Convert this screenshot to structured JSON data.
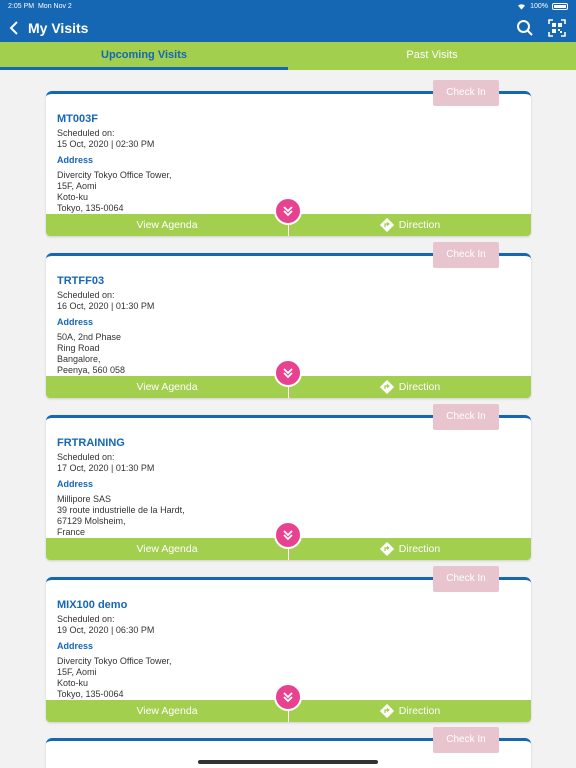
{
  "status_bar": {
    "time": "2:05 PM",
    "date": "Mon Nov 2",
    "battery": "100%"
  },
  "nav": {
    "title": "My Visits",
    "back_icon": "chevron-left-icon",
    "search_icon": "search-icon",
    "scan_icon": "qr-scan-icon"
  },
  "tabs": [
    {
      "label": "Upcoming Visits",
      "active": true
    },
    {
      "label": "Past Visits",
      "active": false
    }
  ],
  "labels": {
    "scheduled_on": "Scheduled on:",
    "address": "Address",
    "check_in": "Check In",
    "view_agenda": "View Agenda",
    "direction": "Direction"
  },
  "visits": [
    {
      "code": "MT003F",
      "scheduled": "15 Oct, 2020 | 02:30 PM",
      "address": [
        "Divercity Tokyo Office Tower,",
        "15F, Aomi",
        "Koto-ku",
        "Tokyo, 135-0064"
      ]
    },
    {
      "code": "TRTFF03",
      "scheduled": "16 Oct, 2020 | 01:30 PM",
      "address": [
        "50A, 2nd Phase",
        "Ring Road",
        "Bangalore,",
        "Peenya, 560 058"
      ]
    },
    {
      "code": "FRTRAINING",
      "scheduled": "17 Oct, 2020 | 01:30 PM",
      "address": [
        "Millipore SAS",
        "39 route industrielle de la Hardt,",
        "67129 Molsheim,",
        "France"
      ]
    },
    {
      "code": "MIX100 demo",
      "scheduled": "19 Oct, 2020 | 06:30 PM",
      "address": [
        "Divercity Tokyo Office Tower,",
        "15F, Aomi",
        "Koto-ku",
        "Tokyo, 135-0064"
      ]
    }
  ],
  "colors": {
    "brand_blue": "#1566b3",
    "accent_green": "#a3cf4f",
    "pink": "#e8428f",
    "checkin_disabled": "#e8c4ce"
  }
}
